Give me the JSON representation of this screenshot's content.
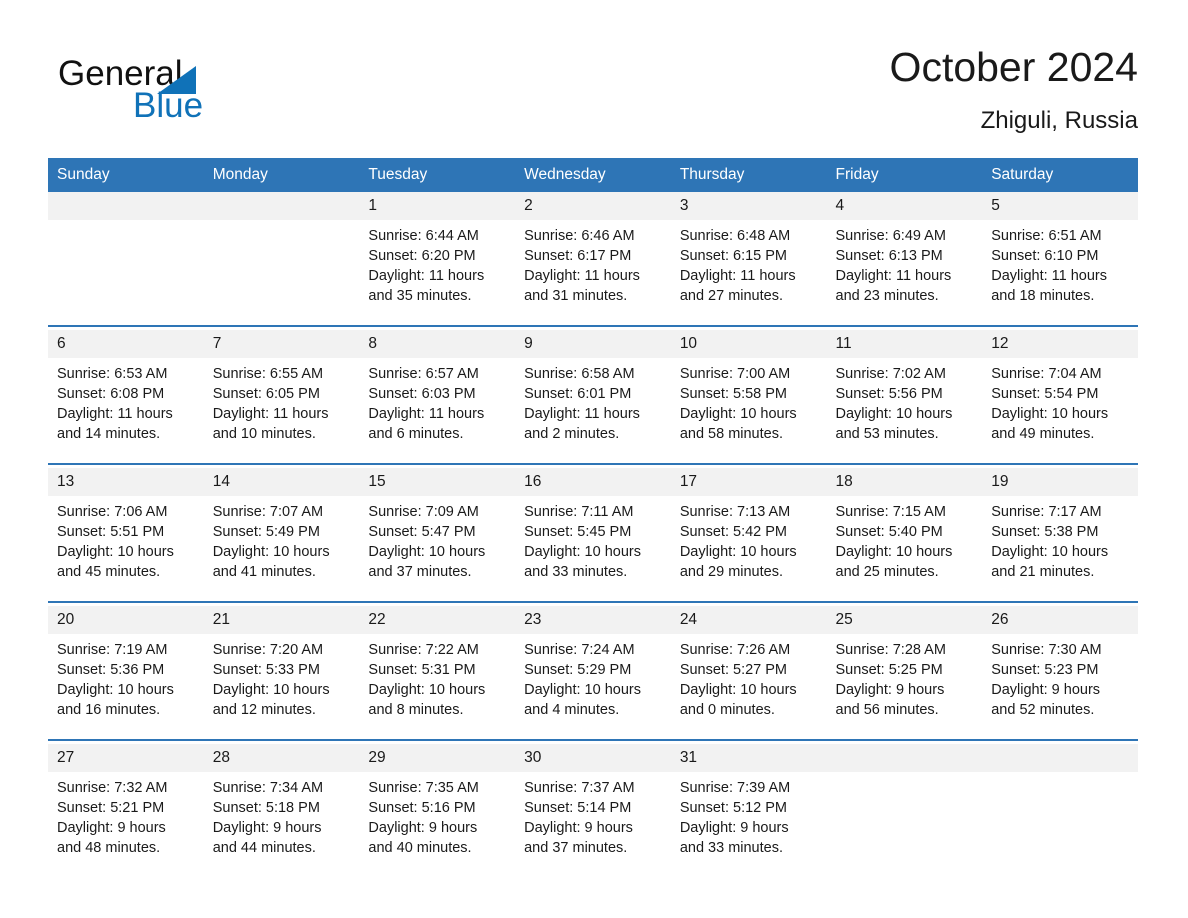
{
  "brand": {
    "name_part1": "General",
    "name_part2": "Blue",
    "accent_color": "#1072b8"
  },
  "header": {
    "month_title": "October 2024",
    "location": "Zhiguli, Russia"
  },
  "theme": {
    "header_blue": "#2e75b6",
    "daynum_band": "#f2f2f2",
    "text": "#1a1a1a"
  },
  "weekday_headers": [
    "Sunday",
    "Monday",
    "Tuesday",
    "Wednesday",
    "Thursday",
    "Friday",
    "Saturday"
  ],
  "weeks": [
    {
      "days": [
        {
          "num": "",
          "sunrise": "",
          "sunset": "",
          "daylight_line1": "",
          "daylight_line2": ""
        },
        {
          "num": "",
          "sunrise": "",
          "sunset": "",
          "daylight_line1": "",
          "daylight_line2": ""
        },
        {
          "num": "1",
          "sunrise": "Sunrise: 6:44 AM",
          "sunset": "Sunset: 6:20 PM",
          "daylight_line1": "Daylight: 11 hours",
          "daylight_line2": "and 35 minutes."
        },
        {
          "num": "2",
          "sunrise": "Sunrise: 6:46 AM",
          "sunset": "Sunset: 6:17 PM",
          "daylight_line1": "Daylight: 11 hours",
          "daylight_line2": "and 31 minutes."
        },
        {
          "num": "3",
          "sunrise": "Sunrise: 6:48 AM",
          "sunset": "Sunset: 6:15 PM",
          "daylight_line1": "Daylight: 11 hours",
          "daylight_line2": "and 27 minutes."
        },
        {
          "num": "4",
          "sunrise": "Sunrise: 6:49 AM",
          "sunset": "Sunset: 6:13 PM",
          "daylight_line1": "Daylight: 11 hours",
          "daylight_line2": "and 23 minutes."
        },
        {
          "num": "5",
          "sunrise": "Sunrise: 6:51 AM",
          "sunset": "Sunset: 6:10 PM",
          "daylight_line1": "Daylight: 11 hours",
          "daylight_line2": "and 18 minutes."
        }
      ]
    },
    {
      "days": [
        {
          "num": "6",
          "sunrise": "Sunrise: 6:53 AM",
          "sunset": "Sunset: 6:08 PM",
          "daylight_line1": "Daylight: 11 hours",
          "daylight_line2": "and 14 minutes."
        },
        {
          "num": "7",
          "sunrise": "Sunrise: 6:55 AM",
          "sunset": "Sunset: 6:05 PM",
          "daylight_line1": "Daylight: 11 hours",
          "daylight_line2": "and 10 minutes."
        },
        {
          "num": "8",
          "sunrise": "Sunrise: 6:57 AM",
          "sunset": "Sunset: 6:03 PM",
          "daylight_line1": "Daylight: 11 hours",
          "daylight_line2": "and 6 minutes."
        },
        {
          "num": "9",
          "sunrise": "Sunrise: 6:58 AM",
          "sunset": "Sunset: 6:01 PM",
          "daylight_line1": "Daylight: 11 hours",
          "daylight_line2": "and 2 minutes."
        },
        {
          "num": "10",
          "sunrise": "Sunrise: 7:00 AM",
          "sunset": "Sunset: 5:58 PM",
          "daylight_line1": "Daylight: 10 hours",
          "daylight_line2": "and 58 minutes."
        },
        {
          "num": "11",
          "sunrise": "Sunrise: 7:02 AM",
          "sunset": "Sunset: 5:56 PM",
          "daylight_line1": "Daylight: 10 hours",
          "daylight_line2": "and 53 minutes."
        },
        {
          "num": "12",
          "sunrise": "Sunrise: 7:04 AM",
          "sunset": "Sunset: 5:54 PM",
          "daylight_line1": "Daylight: 10 hours",
          "daylight_line2": "and 49 minutes."
        }
      ]
    },
    {
      "days": [
        {
          "num": "13",
          "sunrise": "Sunrise: 7:06 AM",
          "sunset": "Sunset: 5:51 PM",
          "daylight_line1": "Daylight: 10 hours",
          "daylight_line2": "and 45 minutes."
        },
        {
          "num": "14",
          "sunrise": "Sunrise: 7:07 AM",
          "sunset": "Sunset: 5:49 PM",
          "daylight_line1": "Daylight: 10 hours",
          "daylight_line2": "and 41 minutes."
        },
        {
          "num": "15",
          "sunrise": "Sunrise: 7:09 AM",
          "sunset": "Sunset: 5:47 PM",
          "daylight_line1": "Daylight: 10 hours",
          "daylight_line2": "and 37 minutes."
        },
        {
          "num": "16",
          "sunrise": "Sunrise: 7:11 AM",
          "sunset": "Sunset: 5:45 PM",
          "daylight_line1": "Daylight: 10 hours",
          "daylight_line2": "and 33 minutes."
        },
        {
          "num": "17",
          "sunrise": "Sunrise: 7:13 AM",
          "sunset": "Sunset: 5:42 PM",
          "daylight_line1": "Daylight: 10 hours",
          "daylight_line2": "and 29 minutes."
        },
        {
          "num": "18",
          "sunrise": "Sunrise: 7:15 AM",
          "sunset": "Sunset: 5:40 PM",
          "daylight_line1": "Daylight: 10 hours",
          "daylight_line2": "and 25 minutes."
        },
        {
          "num": "19",
          "sunrise": "Sunrise: 7:17 AM",
          "sunset": "Sunset: 5:38 PM",
          "daylight_line1": "Daylight: 10 hours",
          "daylight_line2": "and 21 minutes."
        }
      ]
    },
    {
      "days": [
        {
          "num": "20",
          "sunrise": "Sunrise: 7:19 AM",
          "sunset": "Sunset: 5:36 PM",
          "daylight_line1": "Daylight: 10 hours",
          "daylight_line2": "and 16 minutes."
        },
        {
          "num": "21",
          "sunrise": "Sunrise: 7:20 AM",
          "sunset": "Sunset: 5:33 PM",
          "daylight_line1": "Daylight: 10 hours",
          "daylight_line2": "and 12 minutes."
        },
        {
          "num": "22",
          "sunrise": "Sunrise: 7:22 AM",
          "sunset": "Sunset: 5:31 PM",
          "daylight_line1": "Daylight: 10 hours",
          "daylight_line2": "and 8 minutes."
        },
        {
          "num": "23",
          "sunrise": "Sunrise: 7:24 AM",
          "sunset": "Sunset: 5:29 PM",
          "daylight_line1": "Daylight: 10 hours",
          "daylight_line2": "and 4 minutes."
        },
        {
          "num": "24",
          "sunrise": "Sunrise: 7:26 AM",
          "sunset": "Sunset: 5:27 PM",
          "daylight_line1": "Daylight: 10 hours",
          "daylight_line2": "and 0 minutes."
        },
        {
          "num": "25",
          "sunrise": "Sunrise: 7:28 AM",
          "sunset": "Sunset: 5:25 PM",
          "daylight_line1": "Daylight: 9 hours",
          "daylight_line2": "and 56 minutes."
        },
        {
          "num": "26",
          "sunrise": "Sunrise: 7:30 AM",
          "sunset": "Sunset: 5:23 PM",
          "daylight_line1": "Daylight: 9 hours",
          "daylight_line2": "and 52 minutes."
        }
      ]
    },
    {
      "days": [
        {
          "num": "27",
          "sunrise": "Sunrise: 7:32 AM",
          "sunset": "Sunset: 5:21 PM",
          "daylight_line1": "Daylight: 9 hours",
          "daylight_line2": "and 48 minutes."
        },
        {
          "num": "28",
          "sunrise": "Sunrise: 7:34 AM",
          "sunset": "Sunset: 5:18 PM",
          "daylight_line1": "Daylight: 9 hours",
          "daylight_line2": "and 44 minutes."
        },
        {
          "num": "29",
          "sunrise": "Sunrise: 7:35 AM",
          "sunset": "Sunset: 5:16 PM",
          "daylight_line1": "Daylight: 9 hours",
          "daylight_line2": "and 40 minutes."
        },
        {
          "num": "30",
          "sunrise": "Sunrise: 7:37 AM",
          "sunset": "Sunset: 5:14 PM",
          "daylight_line1": "Daylight: 9 hours",
          "daylight_line2": "and 37 minutes."
        },
        {
          "num": "31",
          "sunrise": "Sunrise: 7:39 AM",
          "sunset": "Sunset: 5:12 PM",
          "daylight_line1": "Daylight: 9 hours",
          "daylight_line2": "and 33 minutes."
        },
        {
          "num": "",
          "sunrise": "",
          "sunset": "",
          "daylight_line1": "",
          "daylight_line2": ""
        },
        {
          "num": "",
          "sunrise": "",
          "sunset": "",
          "daylight_line1": "",
          "daylight_line2": ""
        }
      ]
    }
  ]
}
